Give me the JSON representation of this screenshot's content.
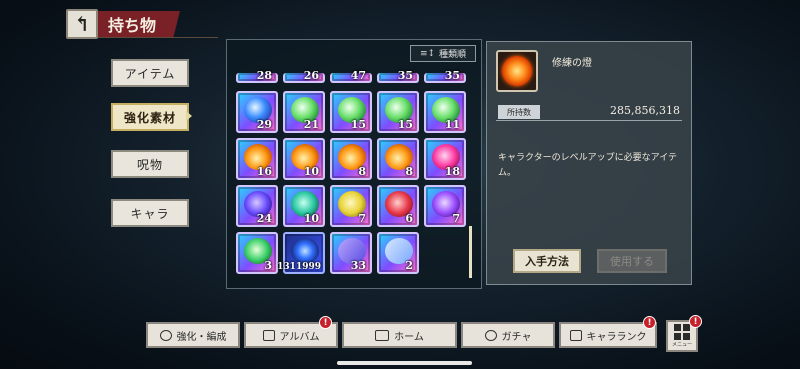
{
  "header": {
    "title": "持ち物",
    "back_icon": "↰"
  },
  "sidebar": {
    "items": [
      {
        "label": "アイテム",
        "active": false
      },
      {
        "label": "強化素材",
        "active": true
      },
      {
        "label": "呪物",
        "active": false
      },
      {
        "label": "キャラ",
        "active": false
      }
    ]
  },
  "inventory": {
    "sort_label": "種類順",
    "sort_icon": "≡↕",
    "peek_row": [
      "28",
      "26",
      "47",
      "35",
      "35"
    ],
    "rows": [
      [
        {
          "count": "29",
          "icon": "blue-crystal-icon"
        },
        {
          "count": "21",
          "icon": "green-crystal-icon"
        },
        {
          "count": "15",
          "icon": "green-crystal-icon"
        },
        {
          "count": "15",
          "icon": "green-crystal-icon"
        },
        {
          "count": "11",
          "icon": "green-crystal-icon"
        }
      ],
      [
        {
          "count": "16",
          "icon": "fire-crystal-icon"
        },
        {
          "count": "10",
          "icon": "fire-crystal-icon"
        },
        {
          "count": "8",
          "icon": "fire-crystal-icon"
        },
        {
          "count": "8",
          "icon": "fire-crystal-icon"
        },
        {
          "count": "18",
          "icon": "pink-key-icon"
        }
      ],
      [
        {
          "count": "24",
          "icon": "purple-key-icon"
        },
        {
          "count": "10",
          "icon": "teal-key-icon"
        },
        {
          "count": "7",
          "icon": "yellow-key-icon"
        },
        {
          "count": "6",
          "icon": "red-key-icon"
        },
        {
          "count": "7",
          "icon": "violet-key-icon"
        }
      ],
      [
        {
          "count": "3",
          "icon": "green-key-icon"
        },
        {
          "count": "1311999",
          "icon": "blue-orb-icon"
        },
        {
          "count": "33",
          "icon": "purple-card-icon"
        },
        {
          "count": "2",
          "icon": "blue-card-icon"
        }
      ]
    ]
  },
  "detail": {
    "item_name": "修練の燈",
    "owned_label": "所持数",
    "owned_value": "285,856,318",
    "description": "キャラクターのレベルアップに必要なアイテム。",
    "obtain_label": "入手方法",
    "use_label": "使用する"
  },
  "bottom_nav": {
    "items": [
      {
        "label": "強化・編成",
        "badge": false
      },
      {
        "label": "アルバム",
        "badge": true
      },
      {
        "label": "ホーム",
        "badge": false
      },
      {
        "label": "ガチャ",
        "badge": false
      },
      {
        "label": "キャラランク",
        "badge": true
      }
    ],
    "menu_label": "メニュー",
    "badge_text": "!"
  }
}
